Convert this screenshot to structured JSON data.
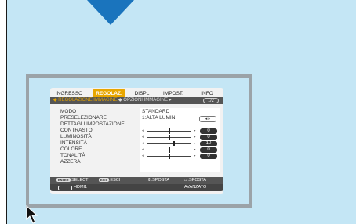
{
  "tabs": [
    "INGRESSO",
    "REGOLAZ.",
    "DISPL",
    "IMPOST.",
    "INFO"
  ],
  "breadcrumb": {
    "current": "◆ REGOLAZIONE IMMAGINE",
    "next": "◆ OPZIONI IMMAGINE ▸",
    "page": "1/2"
  },
  "menu": [
    {
      "label": "MODO",
      "value": "STANDARD"
    },
    {
      "label": "PRESELEZIONARE",
      "value": "1:ALTA LUMIN."
    },
    {
      "label": "DETTAGLI IMPOSTAZIONE"
    },
    {
      "label": "CONTRASTO",
      "value": "0",
      "level": 0.5
    },
    {
      "label": "LUMINOSITÀ",
      "value": "0",
      "level": 0.5
    },
    {
      "label": "INTENSITÀ",
      "value": "10",
      "level": 0.6
    },
    {
      "label": "COLORE",
      "value": "0",
      "level": 0.5
    },
    {
      "label": "TONALITÀ",
      "value": "0",
      "level": 0.5
    },
    {
      "label": "AZZERA"
    }
  ],
  "footer": {
    "enter_key": "ENTER",
    "select": ":SELECT",
    "exit_key": "EXIT",
    "exit": ":ESCI",
    "move_v": "⇕:SPOSTA",
    "move_h": "↔:SPOSTA",
    "source": "HDMI1",
    "mode": "AVANZATO"
  },
  "colors": {
    "accent": "#e8a600",
    "screen": "#c4e6f5",
    "marker": "#1a74bd"
  }
}
